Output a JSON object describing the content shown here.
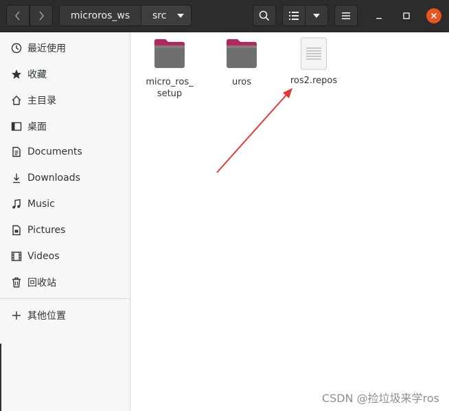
{
  "header": {
    "back_icon": "chevron-left-icon",
    "forward_icon": "chevron-right-icon",
    "breadcrumbs": [
      "microros_ws",
      "src"
    ],
    "breadcrumb_menu_icon": "triangle-down-icon",
    "search_icon": "magnifier-icon",
    "view_icon": "list-view-icon",
    "view_menu_icon": "triangle-down-icon",
    "menu_icon": "hamburger-icon",
    "window_controls": [
      "minimize",
      "maximize",
      "close"
    ],
    "close_color": "#e95420"
  },
  "sidebar": {
    "items": [
      {
        "label": "最近使用",
        "icon": "clock-icon"
      },
      {
        "label": "收藏",
        "icon": "star-icon"
      },
      {
        "label": "主目录",
        "icon": "home-icon"
      },
      {
        "label": "桌面",
        "icon": "desktop-icon"
      },
      {
        "label": "Documents",
        "icon": "document-icon"
      },
      {
        "label": "Downloads",
        "icon": "download-icon"
      },
      {
        "label": "Music",
        "icon": "music-icon"
      },
      {
        "label": "Pictures",
        "icon": "picture-icon"
      },
      {
        "label": "Videos",
        "icon": "video-icon"
      },
      {
        "label": "回收站",
        "icon": "trash-icon"
      }
    ],
    "other_locations": {
      "label": "其他位置",
      "icon": "plus-icon"
    }
  },
  "files": [
    {
      "name_line1": "micro_ros_",
      "name_line2": "setup",
      "type": "folder"
    },
    {
      "name_line1": "uros",
      "name_line2": "",
      "type": "folder"
    },
    {
      "name_line1": "ros2.repos",
      "name_line2": "",
      "type": "text-file"
    }
  ],
  "colors": {
    "header_bg": "#2c2c2c",
    "folder_tab": "#c2185b",
    "folder_body": "#6e6e6e",
    "arrow": "#e53935"
  },
  "watermark": "CSDN @捡垃圾来学ros"
}
